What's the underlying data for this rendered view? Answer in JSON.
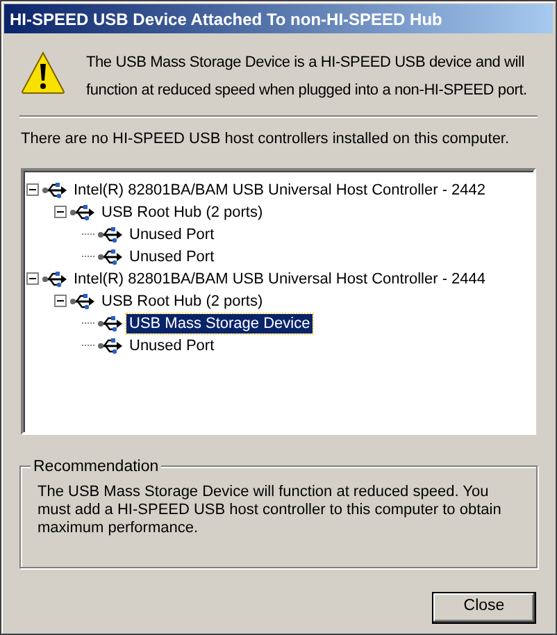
{
  "window": {
    "title": "HI-SPEED USB Device Attached To non-HI-SPEED Hub"
  },
  "message": "The USB Mass Storage Device is a HI-SPEED USB device and will function at reduced speed when plugged into a non-HI-SPEED port.",
  "info": "There are no HI-SPEED USB host controllers installed on this computer.",
  "tree": [
    {
      "label": "Intel(R) 82801BA/BAM USB Universal Host Controller - 2442",
      "expanded": true,
      "selected": false,
      "children": [
        {
          "label": "USB Root Hub (2 ports)",
          "expanded": true,
          "selected": false,
          "children": [
            {
              "label": "Unused Port",
              "selected": false
            },
            {
              "label": "Unused Port",
              "selected": false
            }
          ]
        }
      ]
    },
    {
      "label": "Intel(R) 82801BA/BAM USB Universal Host Controller - 2444",
      "expanded": true,
      "selected": false,
      "children": [
        {
          "label": "USB Root Hub (2 ports)",
          "expanded": true,
          "selected": false,
          "children": [
            {
              "label": "USB Mass Storage Device",
              "selected": true
            },
            {
              "label": "Unused Port",
              "selected": false
            }
          ]
        }
      ]
    }
  ],
  "recommendation": {
    "title": "Recommendation",
    "text": "The USB Mass Storage Device will function at reduced speed. You must add a HI-SPEED USB host controller to this computer to obtain maximum performance."
  },
  "buttons": [
    {
      "label": "Close"
    }
  ]
}
